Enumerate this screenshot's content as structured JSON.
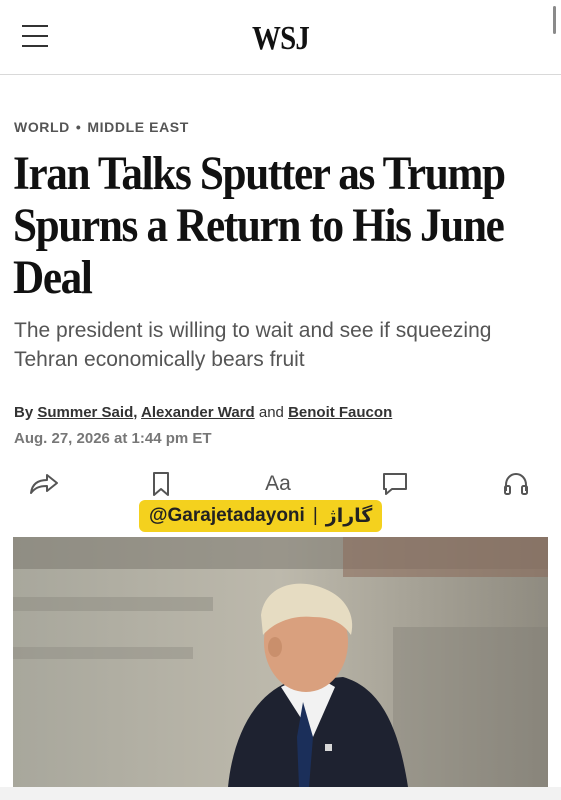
{
  "header": {
    "logo": "WSJ",
    "menu_icon": "hamburger-menu-icon"
  },
  "article": {
    "kicker_section": "WORLD",
    "kicker_subsection": "MIDDLE EAST",
    "kicker_separator": "•",
    "headline": "Iran Talks Sputter as Trump Spurns a Return to His June Deal",
    "dek": "The president is willing to wait and see if squeezing Tehran economically bears fruit",
    "byline_prefix": "By",
    "authors": [
      "Summer Said",
      "Alexander Ward",
      "Benoit Faucon"
    ],
    "author_sep_1": ",",
    "author_sep_2": "and",
    "date": "Aug. 27, 2026 at 1:44 pm ET"
  },
  "toolbar": {
    "share_icon": "share-icon",
    "bookmark_icon": "bookmark-icon",
    "text_size_label": "Aa",
    "comments_icon": "comment-icon",
    "listen_icon": "headphones-icon"
  },
  "watermark": {
    "handle": "@Garajetadayoni",
    "separator": "|",
    "persian": "گاراژ"
  },
  "colors": {
    "watermark_bg": "#f4d11e",
    "text_primary": "#121212",
    "text_secondary": "#555555"
  }
}
